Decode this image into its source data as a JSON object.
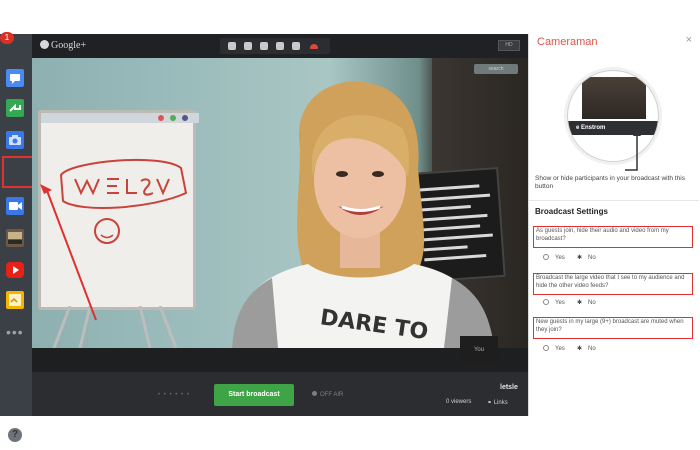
{
  "top_bar": {
    "logo_text": "Google+",
    "right_button": "HD"
  },
  "sidebar": {
    "badge_count": "1",
    "apps": [
      {
        "name": "chat-app-icon",
        "color": "#4a8af4"
      },
      {
        "name": "screenshare-app-icon",
        "color": "#34a853"
      },
      {
        "name": "capture-app-icon",
        "color": "#4a8af4"
      },
      {
        "name": "cameraman-app-icon",
        "color": "#4a8af4"
      },
      {
        "name": "lower-third-app-icon",
        "color": "#9a6b3a"
      },
      {
        "name": "youtube-app-icon",
        "color": "#e62117"
      },
      {
        "name": "notes-app-icon",
        "color": "#f4b400"
      }
    ],
    "more_label": "•••",
    "help_label": "?"
  },
  "video": {
    "search_label": "search",
    "self_tile_label": "You"
  },
  "bottom_bar": {
    "start_broadcast_label": "Start broadcast",
    "off_air_label": "OFF AIR",
    "title": "letsle",
    "viewers": "0 viewers",
    "links_label": "Links"
  },
  "panel": {
    "title": "Cameraman",
    "close_label": "×",
    "preview_name": "e Enstrom",
    "hint_text": "Show or hide participants in your broadcast with this button",
    "settings_title": "Broadcast Settings",
    "questions": [
      {
        "text": "As guests join, hide their audio and video from my broadcast?",
        "yes": "Yes",
        "no": "No",
        "selected": "no"
      },
      {
        "text": "Broadcast the large video that I see to my audience and hide the other video feeds?",
        "yes": "Yes",
        "no": "No",
        "selected": "no"
      },
      {
        "text": "New guests in my large (9+) broadcast are muted when they join?",
        "yes": "Yes",
        "no": "No",
        "selected": "no"
      }
    ]
  },
  "colors": {
    "accent_red": "#e03030",
    "start_green": "#3fa446",
    "panel_title": "#e0554a"
  }
}
